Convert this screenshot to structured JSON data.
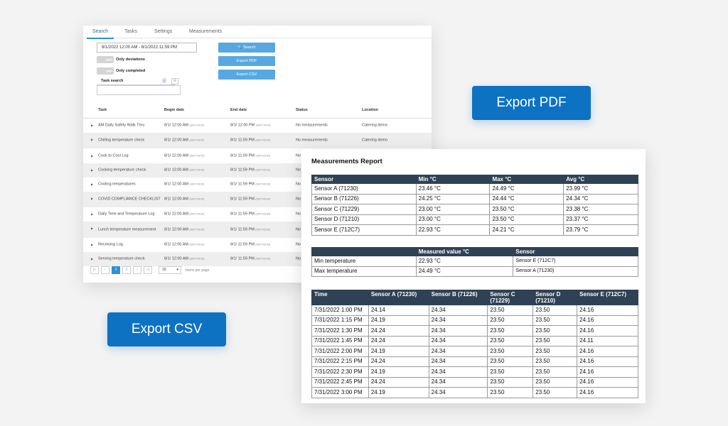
{
  "app": {
    "tabs": [
      "Search",
      "Tasks",
      "Settings",
      "Measurements"
    ],
    "date_range": "8/1/2022 12:00 AM - 8/1/2022 11:59 PM",
    "toggle_off_label": "OFF",
    "only_deviations": "Only deviations",
    "only_completed": "Only completed",
    "task_search_label": "Task search",
    "search_button": "Search",
    "search_icon": "🔍",
    "export_pdf_button": "Export PDF",
    "export_csv_button": "Export CSV",
    "columns": [
      "Task",
      "Begin date",
      "End date",
      "Status",
      "Location"
    ],
    "gmt": "(GMT+03:00)",
    "rows": [
      {
        "task": "AM Daily Safety Walk Thru",
        "begin": "8/1/ 12:00 AM",
        "end": "8/1/ 12:00 PM",
        "status": "No measurements",
        "location": "Catering demo"
      },
      {
        "task": "Chilling temperature check",
        "begin": "8/1/ 12:00 AM",
        "end": "8/1/ 11:59 PM",
        "status": "No measurements",
        "location": "Catering demo"
      },
      {
        "task": "Cook to Cool Log",
        "begin": "8/1/ 12:00 AM",
        "end": "8/1/ 11:59 PM",
        "status": "No",
        "location": ""
      },
      {
        "task": "Cooking temperature check",
        "begin": "8/1/ 12:00 AM",
        "end": "8/1/ 11:59 PM",
        "status": "No",
        "location": ""
      },
      {
        "task": "Cooling temperatures",
        "begin": "8/1/ 12:00 AM",
        "end": "8/1/ 11:59 PM",
        "status": "No",
        "location": ""
      },
      {
        "task": "COVID COMPLIANCE CHECKLIST",
        "begin": "8/1/ 12:00 AM",
        "end": "8/1/ 11:59 PM",
        "status": "No",
        "location": ""
      },
      {
        "task": "Daily Time and Temperature Log",
        "begin": "8/1/ 12:00 AM",
        "end": "8/1/ 11:59 PM",
        "status": "No",
        "location": ""
      },
      {
        "task": "Lunch temperature measurement",
        "begin": "8/1/ 12:00 AM",
        "end": "8/1/ 11:59 PM",
        "status": "No",
        "location": ""
      },
      {
        "task": "Receiving Log",
        "begin": "8/1/ 12:00 AM",
        "end": "8/1/ 11:59 PM",
        "status": "No",
        "location": ""
      },
      {
        "task": "Serving temperature check",
        "begin": "8/1/ 12:00 AM",
        "end": "8/1/ 11:59 PM",
        "status": "No",
        "location": ""
      }
    ],
    "pager": {
      "first": "|«",
      "prev": "‹",
      "pages": [
        "1",
        "2"
      ],
      "next": "›",
      "last": "»|",
      "per_page": "10",
      "per_page_label": "Items per page"
    }
  },
  "report": {
    "title": "Measurements Report",
    "summary": {
      "headers": [
        "Sensor",
        "Min °C",
        "Max °C",
        "Avg °C"
      ],
      "rows": [
        [
          "Sensor A (71230)",
          "23.46 °C",
          "24.49 °C",
          "23.99 °C"
        ],
        [
          "Sensor B (71226)",
          "24.25 °C",
          "24.44 °C",
          "24.34 °C"
        ],
        [
          "Sensor C (71229)",
          "23.00 °C",
          "23.50 °C",
          "23.38 °C"
        ],
        [
          "Sensor D (71210)",
          "23.00 °C",
          "23.50 °C",
          "23.37 °C"
        ],
        [
          "Sensor E (712C7)",
          "22.93 °C",
          "24.21 °C",
          "23.79 °C"
        ]
      ]
    },
    "extremes": {
      "headers": [
        "",
        "Measured value °C",
        "Sensor"
      ],
      "rows": [
        [
          "Min temperature",
          "22.93 °C",
          "Sensor E (712C7)"
        ],
        [
          "Max temperature",
          "24.49 °C",
          "Sensor A (71230)"
        ]
      ]
    },
    "timeseries": {
      "headers": [
        "Time",
        "Sensor A (71230)",
        "Sensor B (71226)",
        "Sensor C (71229)",
        "Sensor D (71210)",
        "Sensor E (712C7)"
      ],
      "rows": [
        [
          "7/31/2022 1:00 PM",
          "24.14",
          "24.34",
          "23.50",
          "23.50",
          "24.16"
        ],
        [
          "7/31/2022 1:15 PM",
          "24.19",
          "24.34",
          "23.50",
          "23.50",
          "24.16"
        ],
        [
          "7/31/2022 1:30 PM",
          "24.24",
          "24.34",
          "23.50",
          "23.50",
          "24.16"
        ],
        [
          "7/31/2022 1:45 PM",
          "24.24",
          "24.34",
          "23.50",
          "23.50",
          "24.11"
        ],
        [
          "7/31/2022 2:00 PM",
          "24.19",
          "24.34",
          "23.50",
          "23.50",
          "24.16"
        ],
        [
          "7/31/2022 2:15 PM",
          "24.24",
          "24.34",
          "23.50",
          "23.50",
          "24.16"
        ],
        [
          "7/31/2022 2:30 PM",
          "24.19",
          "24.34",
          "23.50",
          "23.50",
          "24.16"
        ],
        [
          "7/31/2022 2:45 PM",
          "24.24",
          "24.34",
          "23.50",
          "23.50",
          "24.16"
        ],
        [
          "7/31/2022 3:00 PM",
          "24.19",
          "24.34",
          "23.50",
          "23.50",
          "24.16"
        ]
      ]
    }
  },
  "floating": {
    "export_pdf": "Export PDF",
    "export_csv": "Export CSV"
  },
  "colors": {
    "accent": "#0e72c3",
    "header_dark": "#2f4255",
    "button_light": "#57a8e2"
  }
}
